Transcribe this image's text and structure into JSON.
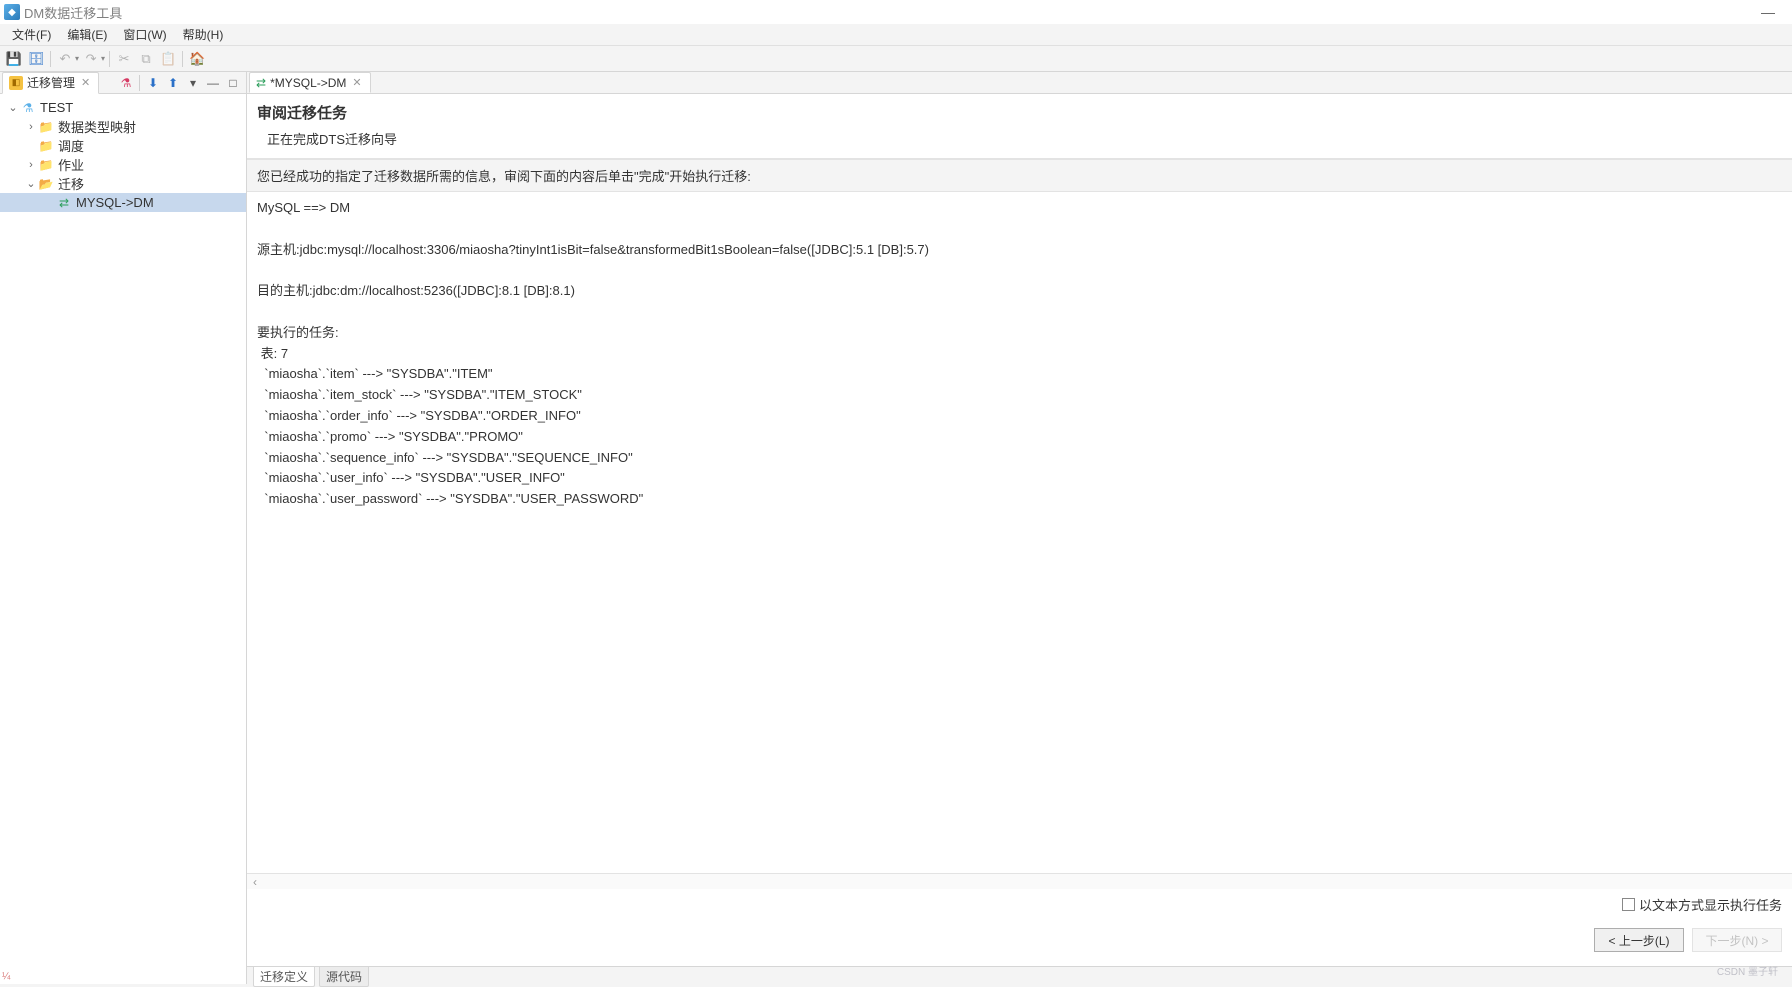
{
  "title": "DM数据迁移工具",
  "menu": {
    "file": "文件(F)",
    "edit": "编辑(E)",
    "window": "窗口(W)",
    "help": "帮助(H)"
  },
  "sidebar": {
    "tab_label": "迁移管理",
    "tree": {
      "root": "TEST",
      "n0": "数据类型映射",
      "n1": "调度",
      "n2": "作业",
      "n3": "迁移",
      "n3_0": "MYSQL->DM"
    }
  },
  "editor_tab": "*MYSQL->DM",
  "page": {
    "title": "审阅迁移任务",
    "subtitle": "正在完成DTS迁移向导",
    "info": "您已经成功的指定了迁移数据所需的信息，审阅下面的内容后单击\"完成\"开始执行迁移:",
    "body": "MySQL ==> DM\n\n源主机:jdbc:mysql://localhost:3306/miaosha?tinyInt1isBit=false&transformedBit1sBoolean=false([JDBC]:5.1 [DB]:5.7)\n\n目的主机:jdbc:dm://localhost:5236([JDBC]:8.1 [DB]:8.1)\n\n要执行的任务:\n 表: 7\n  `miaosha`.`item` ---> \"SYSDBA\".\"ITEM\"\n  `miaosha`.`item_stock` ---> \"SYSDBA\".\"ITEM_STOCK\"\n  `miaosha`.`order_info` ---> \"SYSDBA\".\"ORDER_INFO\"\n  `miaosha`.`promo` ---> \"SYSDBA\".\"PROMO\"\n  `miaosha`.`sequence_info` ---> \"SYSDBA\".\"SEQUENCE_INFO\"\n  `miaosha`.`user_info` ---> \"SYSDBA\".\"USER_INFO\"\n  `miaosha`.`user_password` ---> \"SYSDBA\".\"USER_PASSWORD\""
  },
  "option_text_mode": "以文本方式显示执行任务",
  "buttons": {
    "prev": "< 上一步(L)",
    "next": "下一步(N) >"
  },
  "bottom_tabs": {
    "t0": "迁移定义",
    "t1": "源代码"
  },
  "watermark": "CSDN 墨子轩"
}
